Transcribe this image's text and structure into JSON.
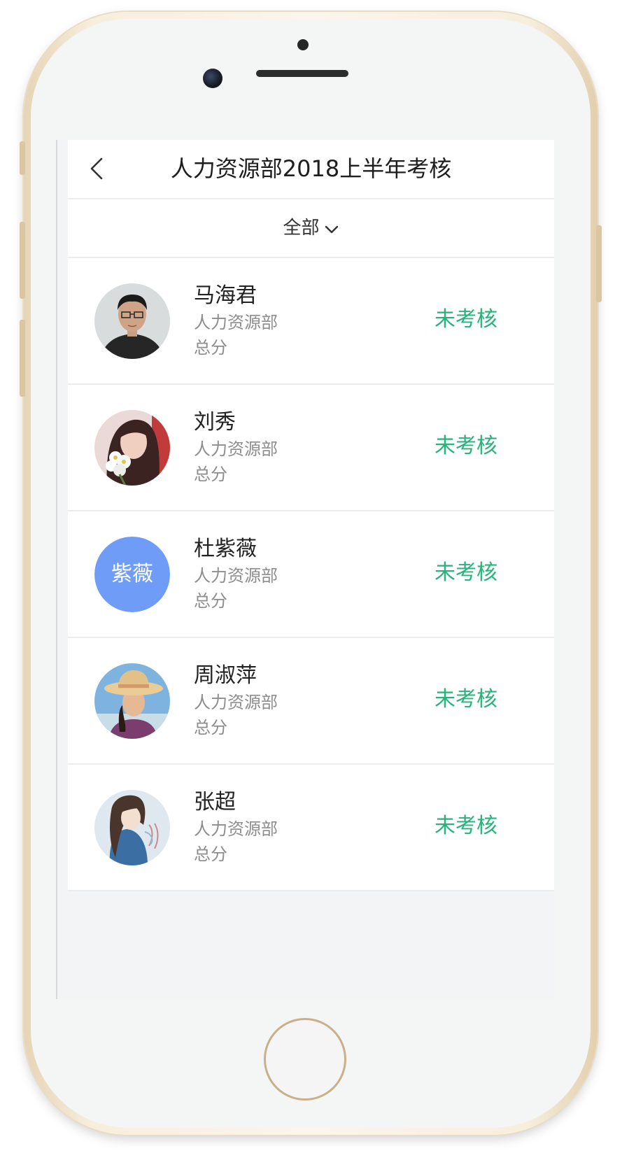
{
  "header": {
    "title": "人力资源部2018上半年考核"
  },
  "filter": {
    "label": "全部"
  },
  "employees": [
    {
      "name": "马海君",
      "department": "人力资源部",
      "score_label": "总分",
      "status": "未考核",
      "avatar": "photo-man-glasses"
    },
    {
      "name": "刘秀",
      "department": "人力资源部",
      "score_label": "总分",
      "status": "未考核",
      "avatar": "photo-woman-flowers"
    },
    {
      "name": "杜紫薇",
      "department": "人力资源部",
      "score_label": "总分",
      "status": "未考核",
      "avatar_text": "紫薇"
    },
    {
      "name": "周淑萍",
      "department": "人力资源部",
      "score_label": "总分",
      "status": "未考核",
      "avatar": "photo-woman-sunhat"
    },
    {
      "name": "张超",
      "department": "人力资源部",
      "score_label": "总分",
      "status": "未考核",
      "avatar": "illustration-anime-girl"
    }
  ],
  "colors": {
    "status_pending": "#27b37a",
    "avatar_text_bg": "#6f9cf6",
    "phone_frame": "#e6d4b6"
  }
}
